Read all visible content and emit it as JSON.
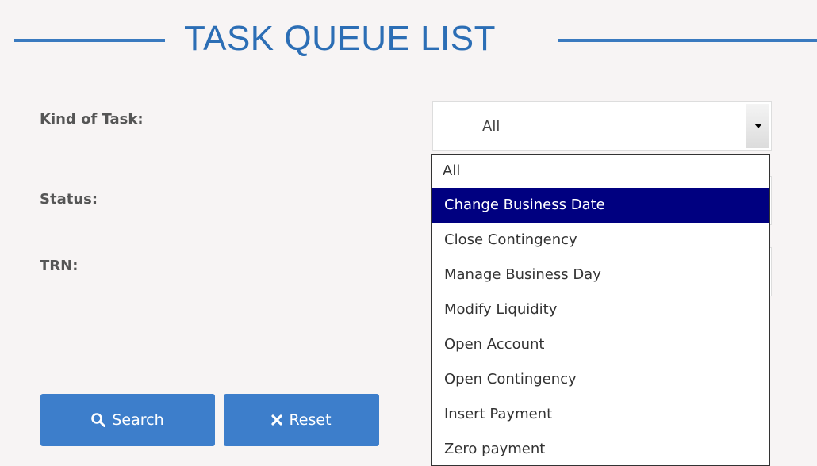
{
  "page": {
    "title": "TASK QUEUE LIST"
  },
  "form": {
    "kind_of_task_label": "Kind of Task:",
    "kind_of_task_value": "All",
    "status_label": "Status:",
    "trn_label": "TRN:"
  },
  "dropdown": {
    "options": [
      "All",
      "Change Business Date",
      "Close Contingency",
      "Manage Business Day",
      "Modify Liquidity",
      "Open Account",
      "Open Contingency",
      "Insert Payment",
      "Zero payment"
    ],
    "selected_option": "Change Business Date"
  },
  "buttons": {
    "search_label": "Search",
    "reset_label": "Reset"
  },
  "colors": {
    "title": "#2c6eb5",
    "button": "#3d7ecb",
    "selected_option": "#000080",
    "divider": "#c47c7c"
  }
}
